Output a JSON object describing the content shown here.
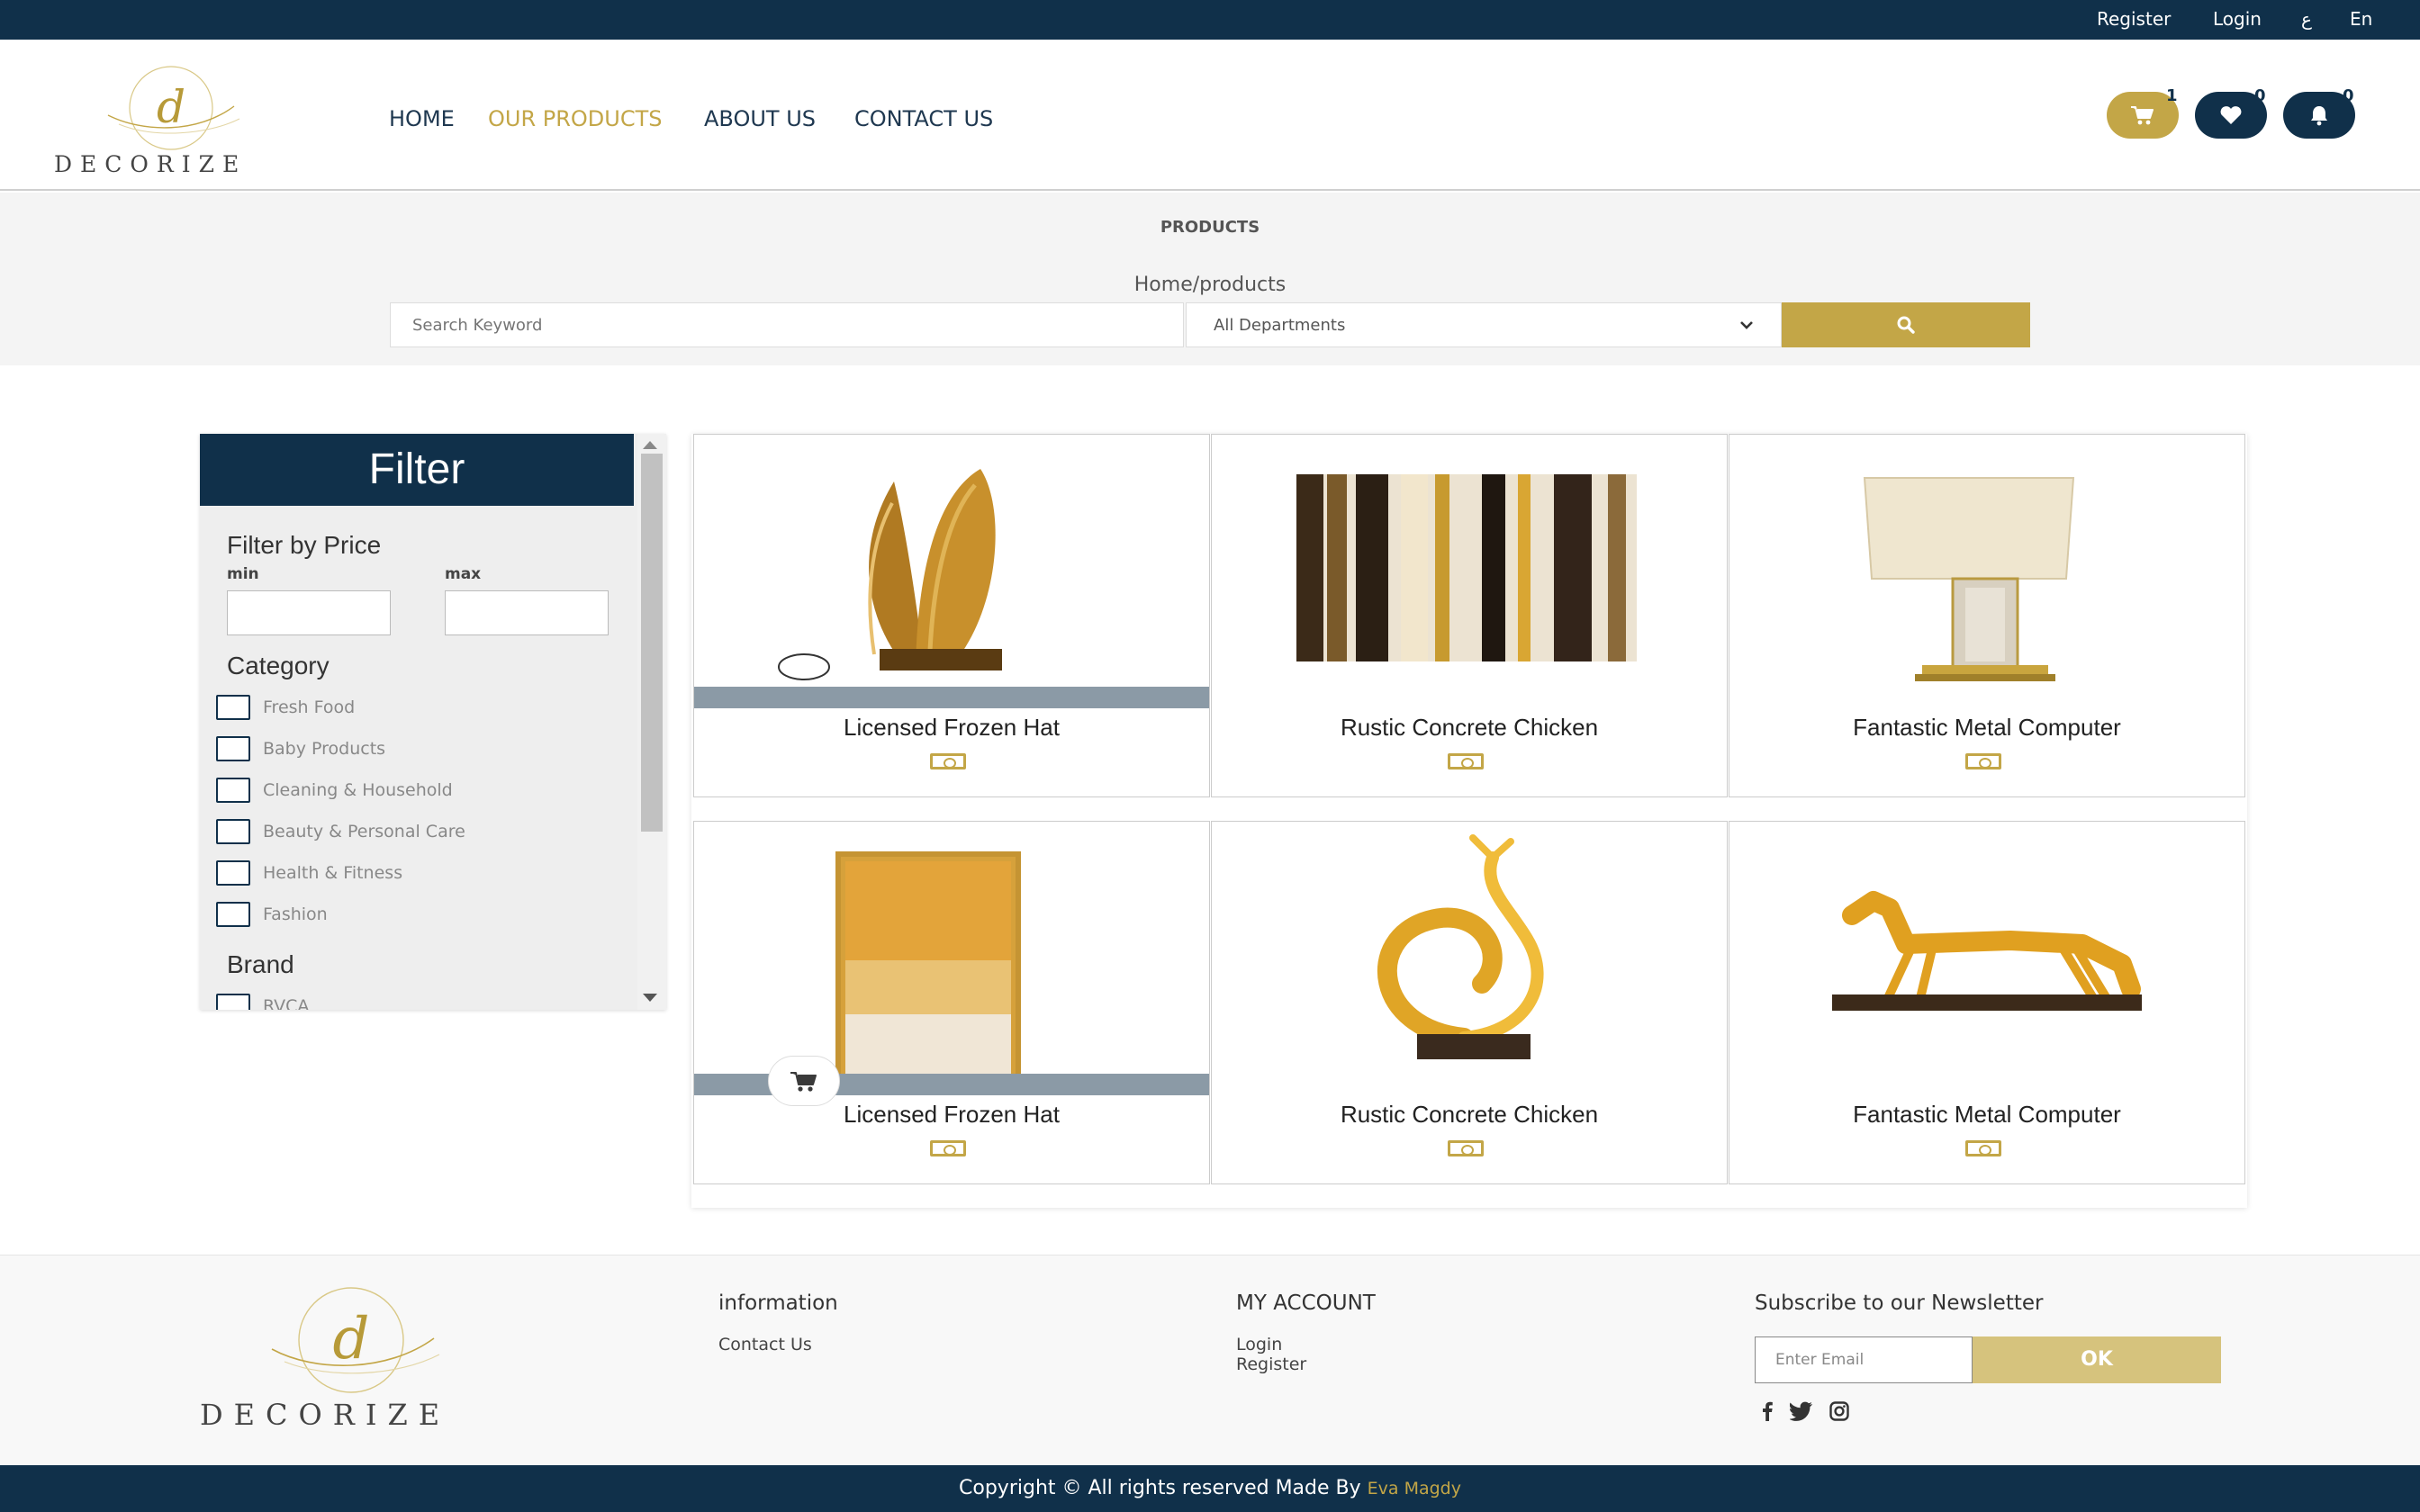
{
  "topbar": {
    "register": "Register",
    "login": "Login",
    "lang_ar": "ع",
    "lang_en": "En"
  },
  "brand": {
    "logo_letter": "d",
    "logo_name": "DECORIZE"
  },
  "nav": {
    "home": "HOME",
    "products": "OUR PRODUCTS",
    "about": "ABOUT US",
    "contact": "CONTACT US"
  },
  "header_counts": {
    "cart": "1",
    "wishlist": "0",
    "notifications": "0"
  },
  "hero": {
    "title": "PRODUCTS",
    "breadcrumb": "Home/products"
  },
  "search": {
    "placeholder": "Search Keyword",
    "department": "All Departments"
  },
  "filter": {
    "title": "Filter",
    "price_heading": "Filter by Price",
    "min_label": "min",
    "max_label": "max",
    "category_heading": "Category",
    "categories": [
      "Fresh Food",
      "Baby Products",
      "Cleaning & Household",
      "Beauty & Personal Care",
      "Health & Fitness",
      "Fashion"
    ],
    "brand_heading": "Brand",
    "brands": [
      "RVCA"
    ]
  },
  "products": [
    {
      "name": "Licensed Frozen Hat",
      "image": "gold-leaf-sculpture"
    },
    {
      "name": "Rustic Concrete Chicken",
      "image": "abstract-painting"
    },
    {
      "name": "Fantastic Metal Computer",
      "image": "table-lamp"
    },
    {
      "name": "Licensed Frozen Hat",
      "image": "gold-panel-art"
    },
    {
      "name": "Rustic Concrete Chicken",
      "image": "gold-swirl-sculpture"
    },
    {
      "name": "Fantastic Metal Computer",
      "image": "gold-horse-statue"
    }
  ],
  "footer": {
    "information_heading": "information",
    "contact_link": "Contact Us",
    "account_heading": "MY ACCOUNT",
    "login_link": "Login",
    "register_link": "Register",
    "newsletter_heading": "Subscribe to our Newsletter",
    "email_placeholder": "Enter Email",
    "ok_button": "OK"
  },
  "copyright": {
    "text": "Copyright © All rights reserved Made By",
    "author": "Eva Magdy"
  },
  "colors": {
    "navy": "#10304a",
    "gold": "#c3a647"
  }
}
